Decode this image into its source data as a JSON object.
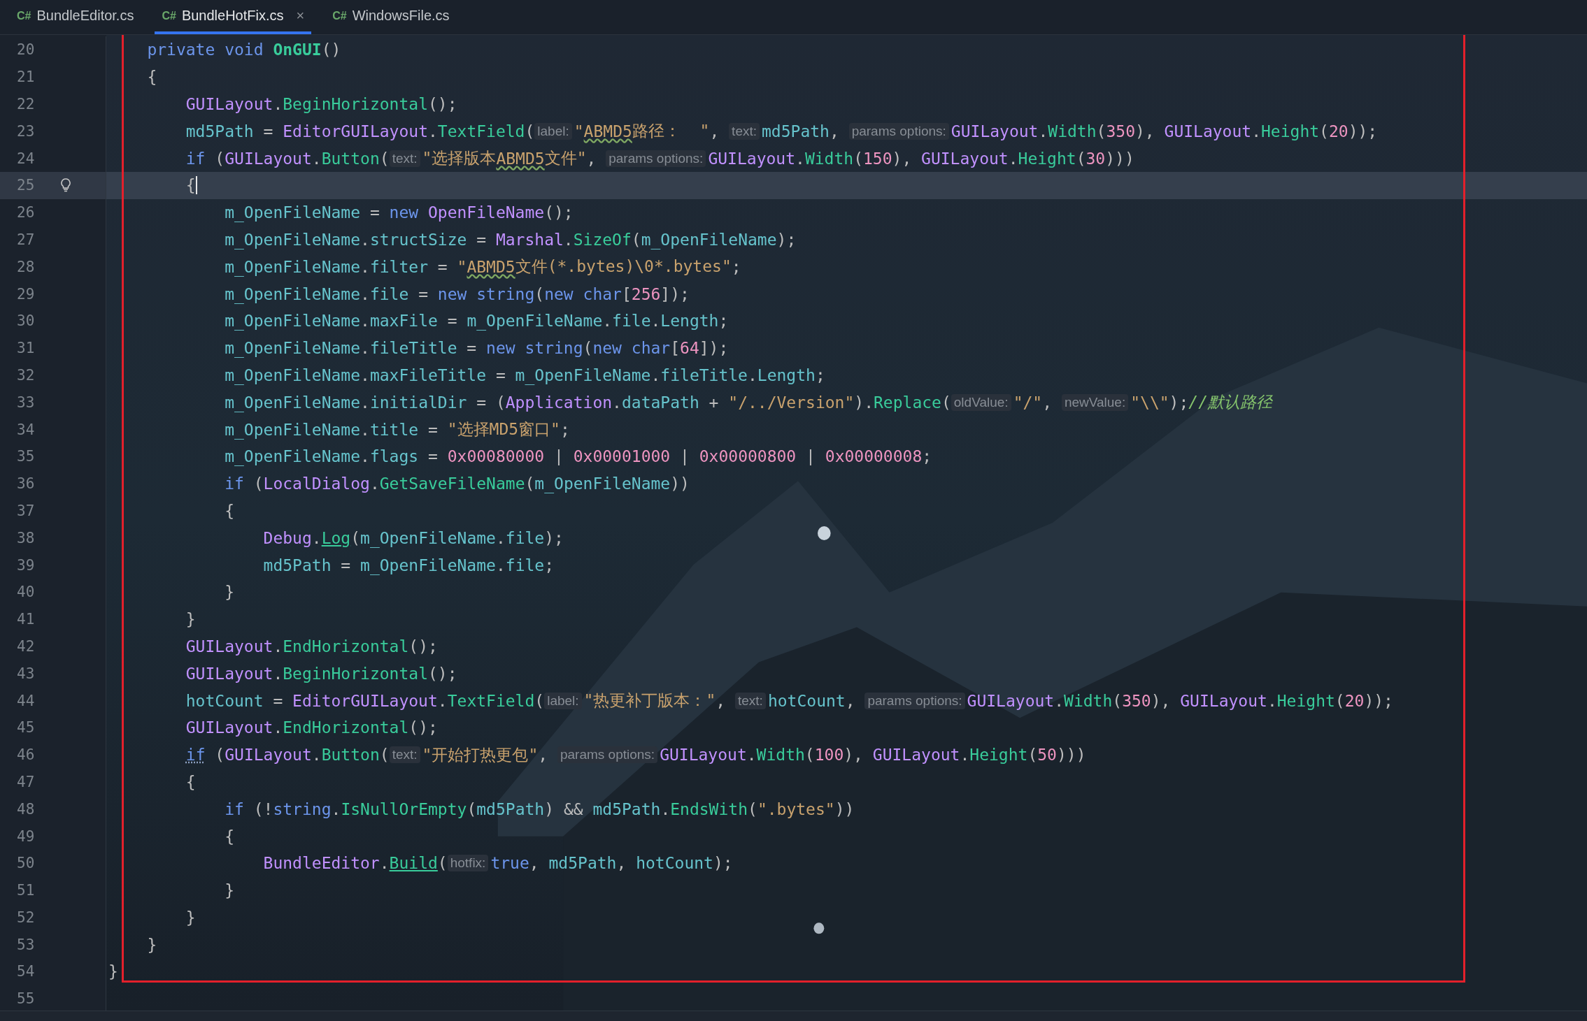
{
  "tabs": [
    {
      "lang": "C#",
      "label": "BundleEditor.cs",
      "selected": false
    },
    {
      "lang": "C#",
      "label": "BundleHotFix.cs",
      "selected": true,
      "close": "×"
    },
    {
      "lang": "C#",
      "label": "WindowsFile.cs",
      "selected": false
    }
  ],
  "lines": [
    {
      "number": "20",
      "current": false,
      "tokens": [
        {
          "kind": "kw",
          "text": "    private "
        },
        {
          "kind": "kw",
          "text": "void "
        },
        {
          "kind": "decl",
          "text": "OnGUI"
        },
        {
          "kind": "p",
          "text": "()"
        }
      ]
    },
    {
      "number": "21",
      "current": false,
      "tokens": [
        {
          "kind": "p",
          "text": "    {"
        }
      ]
    },
    {
      "number": "22",
      "current": false,
      "tokens": [
        {
          "kind": "type",
          "text": "        GUILayout"
        },
        {
          "kind": "p",
          "text": "."
        },
        {
          "kind": "method",
          "text": "BeginHorizontal"
        },
        {
          "kind": "p",
          "text": "();"
        }
      ]
    },
    {
      "number": "23",
      "current": false,
      "tokens": [
        {
          "kind": "field",
          "text": "        md5Path"
        },
        {
          "kind": "p",
          "text": " = "
        },
        {
          "kind": "type",
          "text": "EditorGUILayout"
        },
        {
          "kind": "p",
          "text": "."
        },
        {
          "kind": "method",
          "text": "TextField"
        },
        {
          "kind": "p",
          "text": "("
        },
        {
          "kind": "hint",
          "text": "label:"
        },
        {
          "kind": "str",
          "text": "\""
        },
        {
          "kind": "typo",
          "text": "ABMD5"
        },
        {
          "kind": "str",
          "text": "路径：  \""
        },
        {
          "kind": "p",
          "text": ", "
        },
        {
          "kind": "hint",
          "text": "text:"
        },
        {
          "kind": "field",
          "text": "md5Path"
        },
        {
          "kind": "p",
          "text": ", "
        },
        {
          "kind": "hint",
          "text": "params options:"
        },
        {
          "kind": "type",
          "text": "GUILayout"
        },
        {
          "kind": "p",
          "text": "."
        },
        {
          "kind": "method",
          "text": "Width"
        },
        {
          "kind": "p",
          "text": "("
        },
        {
          "kind": "num",
          "text": "350"
        },
        {
          "kind": "p",
          "text": "), "
        },
        {
          "kind": "type",
          "text": "GUILayout"
        },
        {
          "kind": "p",
          "text": "."
        },
        {
          "kind": "method",
          "text": "Height"
        },
        {
          "kind": "p",
          "text": "("
        },
        {
          "kind": "num",
          "text": "20"
        },
        {
          "kind": "p",
          "text": "));"
        }
      ]
    },
    {
      "number": "24",
      "current": false,
      "tokens": [
        {
          "kind": "kw",
          "text": "        if"
        },
        {
          "kind": "p",
          "text": " ("
        },
        {
          "kind": "type",
          "text": "GUILayout"
        },
        {
          "kind": "p",
          "text": "."
        },
        {
          "kind": "method",
          "text": "Button"
        },
        {
          "kind": "p",
          "text": "("
        },
        {
          "kind": "hint",
          "text": "text:"
        },
        {
          "kind": "str",
          "text": "\"选择版本"
        },
        {
          "kind": "typo",
          "text": "ABMD5"
        },
        {
          "kind": "str",
          "text": "文件\""
        },
        {
          "kind": "p",
          "text": ", "
        },
        {
          "kind": "hint",
          "text": "params options:"
        },
        {
          "kind": "type",
          "text": "GUILayout"
        },
        {
          "kind": "p",
          "text": "."
        },
        {
          "kind": "method",
          "text": "Width"
        },
        {
          "kind": "p",
          "text": "("
        },
        {
          "kind": "num",
          "text": "150"
        },
        {
          "kind": "p",
          "text": "), "
        },
        {
          "kind": "type",
          "text": "GUILayout"
        },
        {
          "kind": "p",
          "text": "."
        },
        {
          "kind": "method",
          "text": "Height"
        },
        {
          "kind": "p",
          "text": "("
        },
        {
          "kind": "num",
          "text": "30"
        },
        {
          "kind": "p",
          "text": ")))"
        }
      ]
    },
    {
      "number": "25",
      "current": true,
      "tokens": [
        {
          "kind": "p",
          "text": "        {"
        }
      ]
    },
    {
      "number": "26",
      "current": false,
      "tokens": [
        {
          "kind": "field",
          "text": "            m_OpenFileName"
        },
        {
          "kind": "p",
          "text": " = "
        },
        {
          "kind": "kw",
          "text": "new "
        },
        {
          "kind": "type",
          "text": "OpenFileName"
        },
        {
          "kind": "p",
          "text": "();"
        }
      ]
    },
    {
      "number": "27",
      "current": false,
      "tokens": [
        {
          "kind": "field",
          "text": "            m_OpenFileName"
        },
        {
          "kind": "p",
          "text": "."
        },
        {
          "kind": "field",
          "text": "structSize"
        },
        {
          "kind": "p",
          "text": " = "
        },
        {
          "kind": "type",
          "text": "Marshal"
        },
        {
          "kind": "p",
          "text": "."
        },
        {
          "kind": "method",
          "text": "SizeOf"
        },
        {
          "kind": "p",
          "text": "("
        },
        {
          "kind": "field",
          "text": "m_OpenFileName"
        },
        {
          "kind": "p",
          "text": ");"
        }
      ]
    },
    {
      "number": "28",
      "current": false,
      "tokens": [
        {
          "kind": "field",
          "text": "            m_OpenFileName"
        },
        {
          "kind": "p",
          "text": "."
        },
        {
          "kind": "field",
          "text": "filter"
        },
        {
          "kind": "p",
          "text": " = "
        },
        {
          "kind": "str",
          "text": "\""
        },
        {
          "kind": "typo",
          "text": "ABMD5"
        },
        {
          "kind": "str",
          "text": "文件(*.bytes)\\0*.bytes\""
        },
        {
          "kind": "p",
          "text": ";"
        }
      ]
    },
    {
      "number": "29",
      "current": false,
      "tokens": [
        {
          "kind": "field",
          "text": "            m_OpenFileName"
        },
        {
          "kind": "p",
          "text": "."
        },
        {
          "kind": "field",
          "text": "file"
        },
        {
          "kind": "p",
          "text": " = "
        },
        {
          "kind": "kw",
          "text": "new string"
        },
        {
          "kind": "p",
          "text": "("
        },
        {
          "kind": "kw",
          "text": "new char"
        },
        {
          "kind": "p",
          "text": "["
        },
        {
          "kind": "num",
          "text": "256"
        },
        {
          "kind": "p",
          "text": "]);"
        }
      ]
    },
    {
      "number": "30",
      "current": false,
      "tokens": [
        {
          "kind": "field",
          "text": "            m_OpenFileName"
        },
        {
          "kind": "p",
          "text": "."
        },
        {
          "kind": "field",
          "text": "maxFile"
        },
        {
          "kind": "p",
          "text": " = "
        },
        {
          "kind": "field",
          "text": "m_OpenFileName"
        },
        {
          "kind": "p",
          "text": "."
        },
        {
          "kind": "field",
          "text": "file"
        },
        {
          "kind": "p",
          "text": "."
        },
        {
          "kind": "field",
          "text": "Length"
        },
        {
          "kind": "p",
          "text": ";"
        }
      ]
    },
    {
      "number": "31",
      "current": false,
      "tokens": [
        {
          "kind": "field",
          "text": "            m_OpenFileName"
        },
        {
          "kind": "p",
          "text": "."
        },
        {
          "kind": "field",
          "text": "fileTitle"
        },
        {
          "kind": "p",
          "text": " = "
        },
        {
          "kind": "kw",
          "text": "new string"
        },
        {
          "kind": "p",
          "text": "("
        },
        {
          "kind": "kw",
          "text": "new char"
        },
        {
          "kind": "p",
          "text": "["
        },
        {
          "kind": "num",
          "text": "64"
        },
        {
          "kind": "p",
          "text": "]);"
        }
      ]
    },
    {
      "number": "32",
      "current": false,
      "tokens": [
        {
          "kind": "field",
          "text": "            m_OpenFileName"
        },
        {
          "kind": "p",
          "text": "."
        },
        {
          "kind": "field",
          "text": "maxFileTitle"
        },
        {
          "kind": "p",
          "text": " = "
        },
        {
          "kind": "field",
          "text": "m_OpenFileName"
        },
        {
          "kind": "p",
          "text": "."
        },
        {
          "kind": "field",
          "text": "fileTitle"
        },
        {
          "kind": "p",
          "text": "."
        },
        {
          "kind": "field",
          "text": "Length"
        },
        {
          "kind": "p",
          "text": ";"
        }
      ]
    },
    {
      "number": "33",
      "current": false,
      "tokens": [
        {
          "kind": "field",
          "text": "            m_OpenFileName"
        },
        {
          "kind": "p",
          "text": "."
        },
        {
          "kind": "field",
          "text": "initialDir"
        },
        {
          "kind": "p",
          "text": " = ("
        },
        {
          "kind": "type",
          "text": "Application"
        },
        {
          "kind": "p",
          "text": "."
        },
        {
          "kind": "field",
          "text": "dataPath"
        },
        {
          "kind": "p",
          "text": " + "
        },
        {
          "kind": "str",
          "text": "\"/../Version\""
        },
        {
          "kind": "p",
          "text": ")."
        },
        {
          "kind": "method",
          "text": "Replace"
        },
        {
          "kind": "p",
          "text": "("
        },
        {
          "kind": "hint",
          "text": "oldValue:"
        },
        {
          "kind": "str",
          "text": "\"/\""
        },
        {
          "kind": "p",
          "text": ", "
        },
        {
          "kind": "hint",
          "text": "newValue:"
        },
        {
          "kind": "str",
          "text": "\"\\\\\""
        },
        {
          "kind": "p",
          "text": ");"
        },
        {
          "kind": "comment",
          "text": "//默认路径"
        }
      ]
    },
    {
      "number": "34",
      "current": false,
      "tokens": [
        {
          "kind": "field",
          "text": "            m_OpenFileName"
        },
        {
          "kind": "p",
          "text": "."
        },
        {
          "kind": "field",
          "text": "title"
        },
        {
          "kind": "p",
          "text": " = "
        },
        {
          "kind": "str",
          "text": "\"选择MD5窗口\""
        },
        {
          "kind": "p",
          "text": ";"
        }
      ]
    },
    {
      "number": "35",
      "current": false,
      "tokens": [
        {
          "kind": "field",
          "text": "            m_OpenFileName"
        },
        {
          "kind": "p",
          "text": "."
        },
        {
          "kind": "field",
          "text": "flags"
        },
        {
          "kind": "p",
          "text": " = "
        },
        {
          "kind": "num",
          "text": "0x00080000"
        },
        {
          "kind": "p",
          "text": " | "
        },
        {
          "kind": "num",
          "text": "0x00001000"
        },
        {
          "kind": "p",
          "text": " | "
        },
        {
          "kind": "num",
          "text": "0x00000800"
        },
        {
          "kind": "p",
          "text": " | "
        },
        {
          "kind": "num",
          "text": "0x00000008"
        },
        {
          "kind": "p",
          "text": ";"
        }
      ]
    },
    {
      "number": "36",
      "current": false,
      "tokens": [
        {
          "kind": "kw",
          "text": "            if"
        },
        {
          "kind": "p",
          "text": " ("
        },
        {
          "kind": "type",
          "text": "LocalDialog"
        },
        {
          "kind": "p",
          "text": "."
        },
        {
          "kind": "method",
          "text": "GetSaveFileName"
        },
        {
          "kind": "p",
          "text": "("
        },
        {
          "kind": "field",
          "text": "m_OpenFileName"
        },
        {
          "kind": "p",
          "text": "))"
        }
      ]
    },
    {
      "number": "37",
      "current": false,
      "tokens": [
        {
          "kind": "p",
          "text": "            {"
        }
      ]
    },
    {
      "number": "38",
      "current": false,
      "tokens": [
        {
          "kind": "type",
          "text": "                Debug"
        },
        {
          "kind": "p",
          "text": "."
        },
        {
          "kind": "link",
          "text": "Log"
        },
        {
          "kind": "p",
          "text": "("
        },
        {
          "kind": "field",
          "text": "m_OpenFileName"
        },
        {
          "kind": "p",
          "text": "."
        },
        {
          "kind": "field",
          "text": "file"
        },
        {
          "kind": "p",
          "text": ");"
        }
      ]
    },
    {
      "number": "39",
      "current": false,
      "tokens": [
        {
          "kind": "field",
          "text": "                md5Path"
        },
        {
          "kind": "p",
          "text": " = "
        },
        {
          "kind": "field",
          "text": "m_OpenFileName"
        },
        {
          "kind": "p",
          "text": "."
        },
        {
          "kind": "field",
          "text": "file"
        },
        {
          "kind": "p",
          "text": ";"
        }
      ]
    },
    {
      "number": "40",
      "current": false,
      "tokens": [
        {
          "kind": "p",
          "text": "            }"
        }
      ]
    },
    {
      "number": "41",
      "current": false,
      "tokens": [
        {
          "kind": "p",
          "text": "        }"
        }
      ]
    },
    {
      "number": "42",
      "current": false,
      "tokens": [
        {
          "kind": "type",
          "text": "        GUILayout"
        },
        {
          "kind": "p",
          "text": "."
        },
        {
          "kind": "method",
          "text": "EndHorizontal"
        },
        {
          "kind": "p",
          "text": "();"
        }
      ]
    },
    {
      "number": "43",
      "current": false,
      "tokens": [
        {
          "kind": "type",
          "text": "        GUILayout"
        },
        {
          "kind": "p",
          "text": "."
        },
        {
          "kind": "method",
          "text": "BeginHorizontal"
        },
        {
          "kind": "p",
          "text": "();"
        }
      ]
    },
    {
      "number": "44",
      "current": false,
      "tokens": [
        {
          "kind": "field",
          "text": "        hotCount"
        },
        {
          "kind": "p",
          "text": " = "
        },
        {
          "kind": "type",
          "text": "EditorGUILayout"
        },
        {
          "kind": "p",
          "text": "."
        },
        {
          "kind": "method",
          "text": "TextField"
        },
        {
          "kind": "p",
          "text": "("
        },
        {
          "kind": "hint",
          "text": "label:"
        },
        {
          "kind": "str",
          "text": "\"热更补丁版本：\""
        },
        {
          "kind": "p",
          "text": ", "
        },
        {
          "kind": "hint",
          "text": "text:"
        },
        {
          "kind": "field",
          "text": "hotCount"
        },
        {
          "kind": "p",
          "text": ", "
        },
        {
          "kind": "hint",
          "text": "params options:"
        },
        {
          "kind": "type",
          "text": "GUILayout"
        },
        {
          "kind": "p",
          "text": "."
        },
        {
          "kind": "method",
          "text": "Width"
        },
        {
          "kind": "p",
          "text": "("
        },
        {
          "kind": "num",
          "text": "350"
        },
        {
          "kind": "p",
          "text": "), "
        },
        {
          "kind": "type",
          "text": "GUILayout"
        },
        {
          "kind": "p",
          "text": "."
        },
        {
          "kind": "method",
          "text": "Height"
        },
        {
          "kind": "p",
          "text": "("
        },
        {
          "kind": "num",
          "text": "20"
        },
        {
          "kind": "p",
          "text": "));"
        }
      ]
    },
    {
      "number": "45",
      "current": false,
      "tokens": [
        {
          "kind": "type",
          "text": "        GUILayout"
        },
        {
          "kind": "p",
          "text": "."
        },
        {
          "kind": "method",
          "text": "EndHorizontal"
        },
        {
          "kind": "p",
          "text": "();"
        }
      ]
    },
    {
      "number": "46",
      "current": false,
      "tokens": [
        {
          "kind": "dotted",
          "text": "        if"
        },
        {
          "kind": "p",
          "text": " ("
        },
        {
          "kind": "type",
          "text": "GUILayout"
        },
        {
          "kind": "p",
          "text": "."
        },
        {
          "kind": "method",
          "text": "Button"
        },
        {
          "kind": "p",
          "text": "("
        },
        {
          "kind": "hint",
          "text": "text:"
        },
        {
          "kind": "str",
          "text": "\"开始打热更包\""
        },
        {
          "kind": "p",
          "text": ", "
        },
        {
          "kind": "hint",
          "text": "params options:"
        },
        {
          "kind": "type",
          "text": "GUILayout"
        },
        {
          "kind": "p",
          "text": "."
        },
        {
          "kind": "method",
          "text": "Width"
        },
        {
          "kind": "p",
          "text": "("
        },
        {
          "kind": "num",
          "text": "100"
        },
        {
          "kind": "p",
          "text": "), "
        },
        {
          "kind": "type",
          "text": "GUILayout"
        },
        {
          "kind": "p",
          "text": "."
        },
        {
          "kind": "method",
          "text": "Height"
        },
        {
          "kind": "p",
          "text": "("
        },
        {
          "kind": "num",
          "text": "50"
        },
        {
          "kind": "p",
          "text": ")))"
        }
      ]
    },
    {
      "number": "47",
      "current": false,
      "tokens": [
        {
          "kind": "p",
          "text": "        {"
        }
      ]
    },
    {
      "number": "48",
      "current": false,
      "tokens": [
        {
          "kind": "kw",
          "text": "            if"
        },
        {
          "kind": "p",
          "text": " (!"
        },
        {
          "kind": "kw",
          "text": "string"
        },
        {
          "kind": "p",
          "text": "."
        },
        {
          "kind": "method",
          "text": "IsNullOrEmpty"
        },
        {
          "kind": "p",
          "text": "("
        },
        {
          "kind": "field",
          "text": "md5Path"
        },
        {
          "kind": "p",
          "text": ") && "
        },
        {
          "kind": "field",
          "text": "md5Path"
        },
        {
          "kind": "p",
          "text": "."
        },
        {
          "kind": "method",
          "text": "EndsWith"
        },
        {
          "kind": "p",
          "text": "("
        },
        {
          "kind": "str",
          "text": "\".bytes\""
        },
        {
          "kind": "p",
          "text": "))"
        }
      ]
    },
    {
      "number": "49",
      "current": false,
      "tokens": [
        {
          "kind": "p",
          "text": "            {"
        }
      ]
    },
    {
      "number": "50",
      "current": false,
      "tokens": [
        {
          "kind": "type",
          "text": "                BundleEditor"
        },
        {
          "kind": "p",
          "text": "."
        },
        {
          "kind": "link",
          "text": "Build"
        },
        {
          "kind": "p",
          "text": "("
        },
        {
          "kind": "hint",
          "text": "hotfix:"
        },
        {
          "kind": "kw",
          "text": "true"
        },
        {
          "kind": "p",
          "text": ", "
        },
        {
          "kind": "field",
          "text": "md5Path"
        },
        {
          "kind": "p",
          "text": ", "
        },
        {
          "kind": "field",
          "text": "hotCount"
        },
        {
          "kind": "p",
          "text": ");"
        }
      ]
    },
    {
      "number": "51",
      "current": false,
      "tokens": [
        {
          "kind": "p",
          "text": "            }"
        }
      ]
    },
    {
      "number": "52",
      "current": false,
      "tokens": [
        {
          "kind": "p",
          "text": "        }"
        }
      ]
    },
    {
      "number": "53",
      "current": false,
      "tokens": [
        {
          "kind": "p",
          "text": "    }"
        }
      ]
    },
    {
      "number": "54",
      "current": false,
      "tokens": [
        {
          "kind": "p",
          "text": "}"
        }
      ]
    },
    {
      "number": "55",
      "current": false
    }
  ]
}
